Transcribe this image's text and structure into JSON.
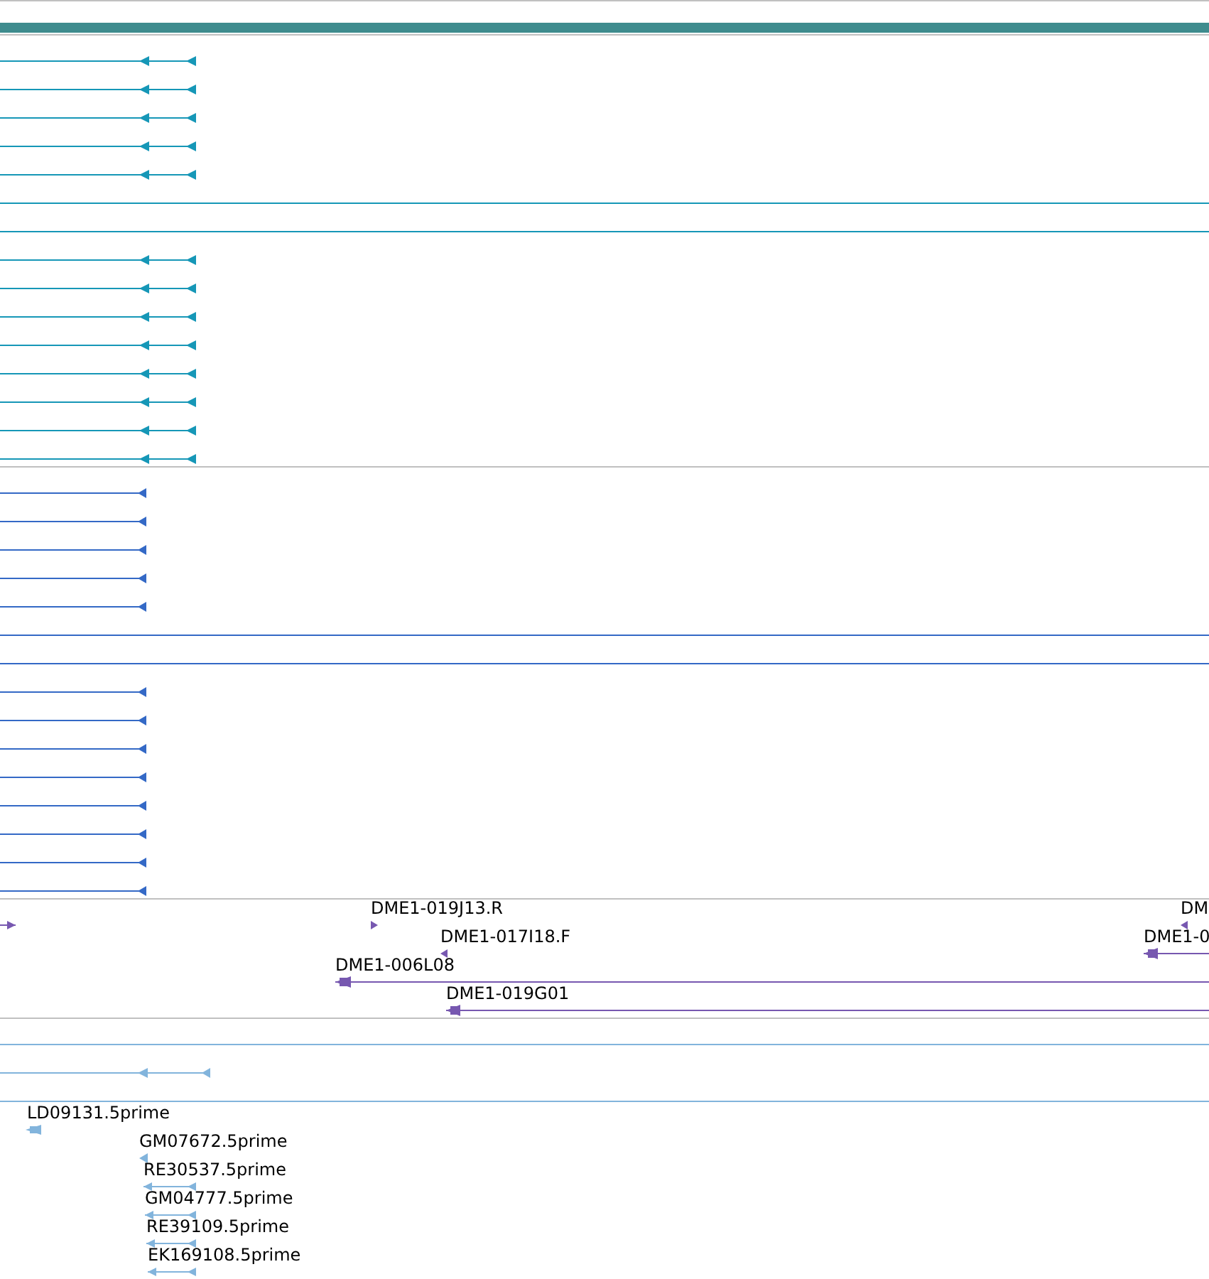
{
  "header": {
    "kind": "bar"
  },
  "tracks": [
    {
      "color": "#1697b7",
      "rows": [
        {
          "features": [
            {
              "kind": "glyph"
            }
          ]
        },
        {
          "features": [
            {
              "kind": "glyph"
            }
          ]
        },
        {
          "features": [
            {
              "kind": "glyph"
            }
          ]
        },
        {
          "features": [
            {
              "kind": "glyph"
            }
          ]
        },
        {
          "features": [
            {
              "kind": "glyph"
            }
          ]
        },
        {
          "features": [
            {
              "kind": "span"
            }
          ]
        },
        {
          "features": [
            {
              "kind": "span"
            }
          ]
        },
        {
          "features": [
            {
              "kind": "glyph"
            }
          ]
        },
        {
          "features": [
            {
              "kind": "glyph"
            }
          ]
        },
        {
          "features": [
            {
              "kind": "glyph"
            }
          ]
        },
        {
          "features": [
            {
              "kind": "glyph"
            }
          ]
        },
        {
          "features": [
            {
              "kind": "glyph"
            }
          ]
        },
        {
          "features": [
            {
              "kind": "glyph"
            }
          ]
        },
        {
          "features": [
            {
              "kind": "glyph"
            }
          ]
        },
        {
          "features": [
            {
              "kind": "glyph"
            }
          ]
        }
      ]
    },
    {
      "color": "#3469c6",
      "rows": [
        {
          "features": [
            {
              "kind": "glyph"
            }
          ]
        },
        {
          "features": [
            {
              "kind": "glyph"
            }
          ]
        },
        {
          "features": [
            {
              "kind": "glyph"
            }
          ]
        },
        {
          "features": [
            {
              "kind": "glyph"
            }
          ]
        },
        {
          "features": [
            {
              "kind": "glyph"
            }
          ]
        },
        {
          "features": [
            {
              "kind": "span"
            }
          ]
        },
        {
          "features": [
            {
              "kind": "span"
            }
          ]
        },
        {
          "features": [
            {
              "kind": "glyph"
            }
          ]
        },
        {
          "features": [
            {
              "kind": "glyph"
            }
          ]
        },
        {
          "features": [
            {
              "kind": "glyph"
            }
          ]
        },
        {
          "features": [
            {
              "kind": "glyph"
            }
          ]
        },
        {
          "features": [
            {
              "kind": "glyph"
            }
          ]
        },
        {
          "features": [
            {
              "kind": "glyph"
            }
          ]
        },
        {
          "features": [
            {
              "kind": "glyph"
            }
          ]
        },
        {
          "features": [
            {
              "kind": "glyph"
            }
          ]
        }
      ]
    },
    {
      "color": "#7758b0",
      "rows": [
        {
          "features": [
            {
              "kind": "glyph"
            },
            {
              "kind": "glyph",
              "label": "DME1-019J13.R"
            },
            {
              "kind": "glyph",
              "label": "DM"
            }
          ]
        },
        {
          "features": [
            {
              "kind": "glyph",
              "label": "DME1-017I18.F"
            },
            {
              "kind": "glyph",
              "label": "DME1-0"
            }
          ]
        },
        {
          "features": [
            {
              "kind": "glyph",
              "label": "DME1-006L08"
            }
          ]
        },
        {
          "features": [
            {
              "kind": "glyph",
              "label": "DME1-019G01"
            }
          ]
        }
      ]
    },
    {
      "color": "#82b4dc",
      "rows": [
        {
          "features": [
            {
              "kind": "span"
            }
          ]
        },
        {
          "features": [
            {
              "kind": "glyph"
            }
          ]
        },
        {
          "features": [
            {
              "kind": "span"
            }
          ]
        },
        {
          "features": [
            {
              "kind": "glyph",
              "label": "LD09131.5prime"
            }
          ]
        },
        {
          "features": [
            {
              "kind": "glyph",
              "label": "GM07672.5prime"
            }
          ]
        },
        {
          "features": [
            {
              "kind": "glyph",
              "label": "RE30537.5prime"
            }
          ]
        },
        {
          "features": [
            {
              "kind": "glyph",
              "label": "GM04777.5prime"
            }
          ]
        },
        {
          "features": [
            {
              "kind": "glyph",
              "label": "RE39109.5prime"
            }
          ]
        },
        {
          "features": [
            {
              "kind": "glyph",
              "label": "EK169108.5prime"
            }
          ]
        }
      ]
    }
  ]
}
